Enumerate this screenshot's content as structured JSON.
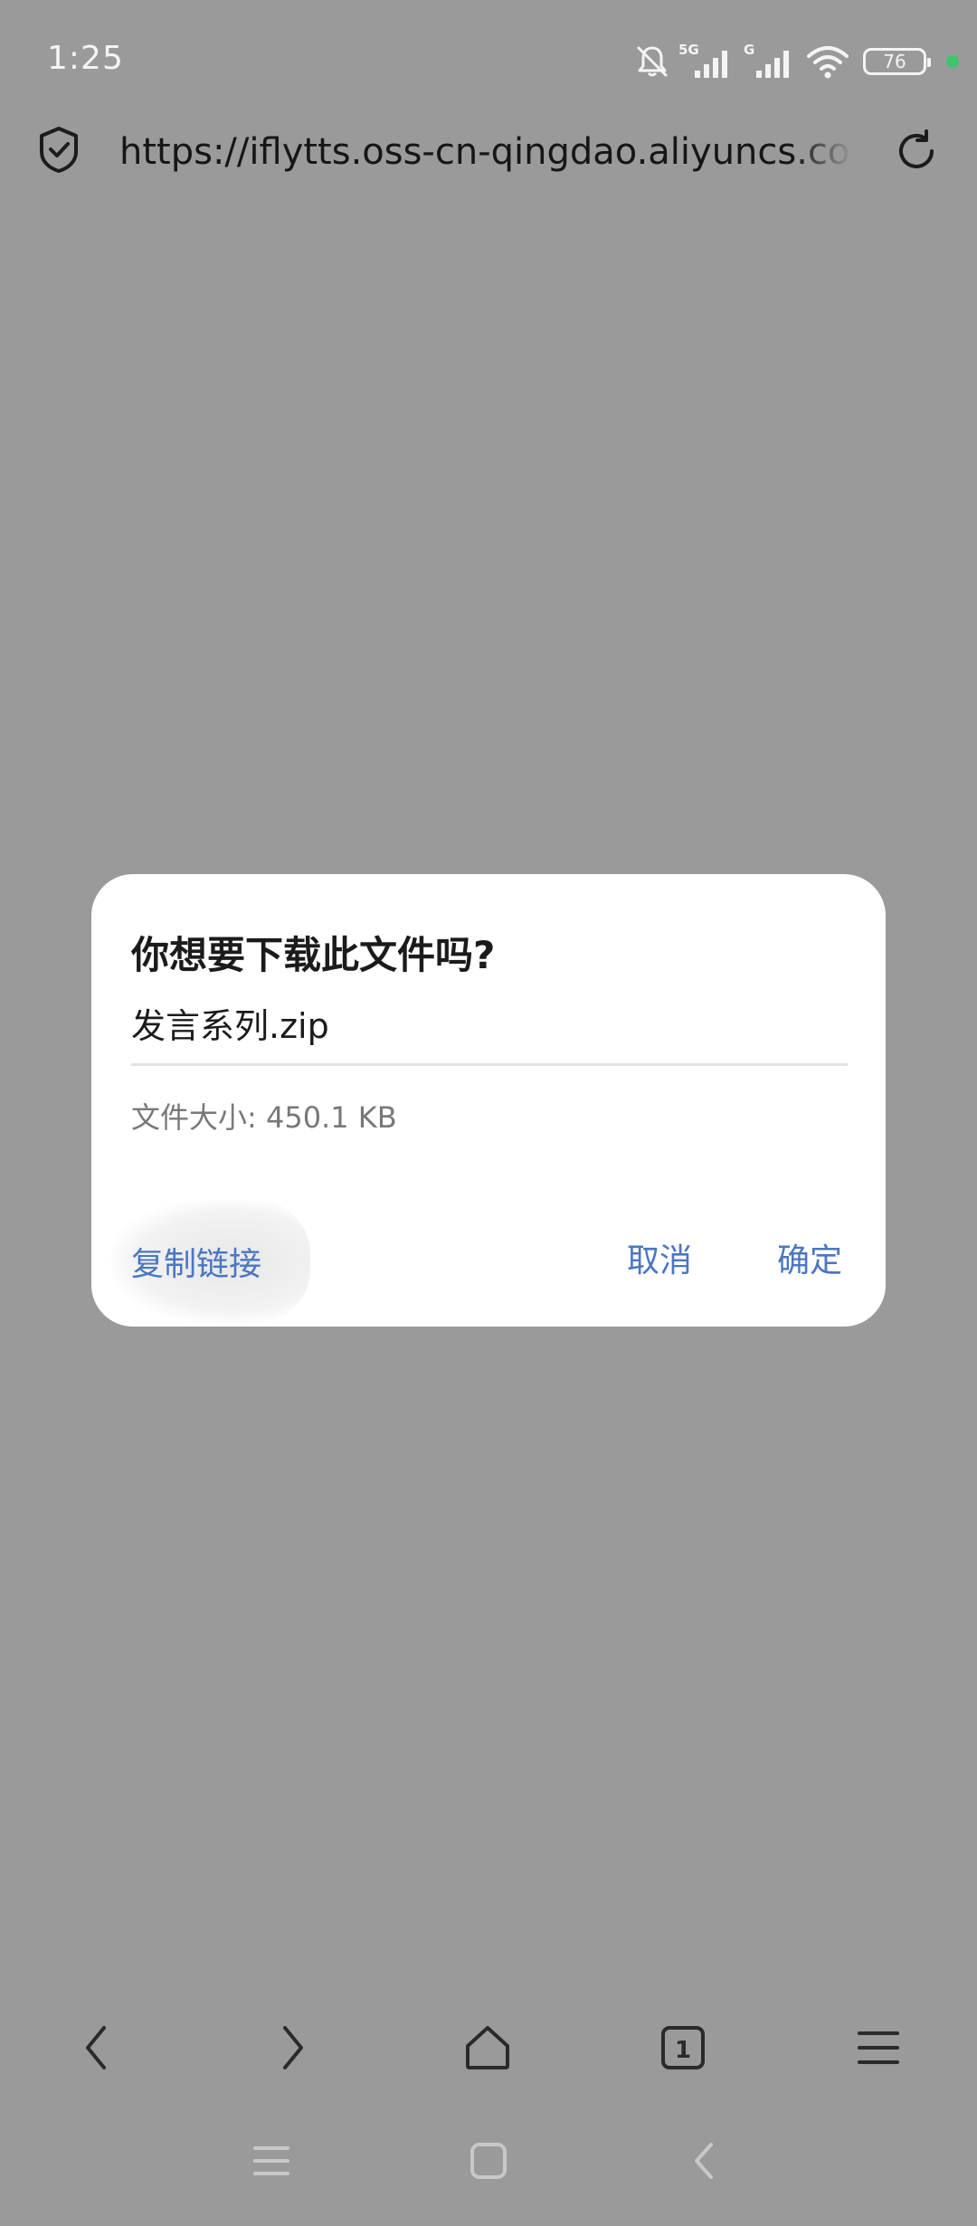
{
  "status_bar": {
    "time": "1:25",
    "network_5g_label": "5G",
    "network_g_label": "G",
    "battery_level": "76",
    "privacy_indicator_color": "#3ec46d"
  },
  "url_bar": {
    "url": "https://iflytts.oss-cn-qingdao.aliyuncs.com"
  },
  "dialog": {
    "title": "你想要下载此文件吗?",
    "filename": "发言系列.zip",
    "file_size_label": "文件大小:",
    "file_size_value": "450.1 KB",
    "copy_link_label": "复制链接",
    "cancel_label": "取消",
    "confirm_label": "确定",
    "accent_color": "#4a76c2"
  },
  "browser_toolbar": {
    "tab_count": "1"
  },
  "theme": {
    "background_scrim": "#9a9a9a"
  }
}
